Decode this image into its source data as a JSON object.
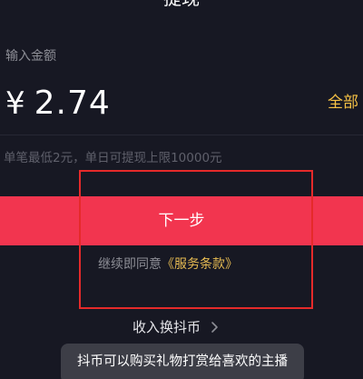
{
  "header": {
    "title": "提现"
  },
  "withdraw": {
    "amount_label": "输入金额",
    "currency_symbol": "¥",
    "amount": "2.74",
    "all_label": "全部",
    "limit_hint": "单笔最低2元，单日可提现上限10000元",
    "next_button_label": "下一步",
    "agree_prefix": "继续即同意",
    "terms_link": "《服务条款》",
    "convert_link": "收入换抖币",
    "tooltip_text": "抖币可以购买礼物打赏给喜欢的主播"
  },
  "icons": {
    "convert_chevron": "chevron-right-icon"
  },
  "colors": {
    "background": "#171823",
    "primary_button": "#f2354f",
    "accent_gold": "#f7c245",
    "annotation_box": "#e52a2a"
  }
}
